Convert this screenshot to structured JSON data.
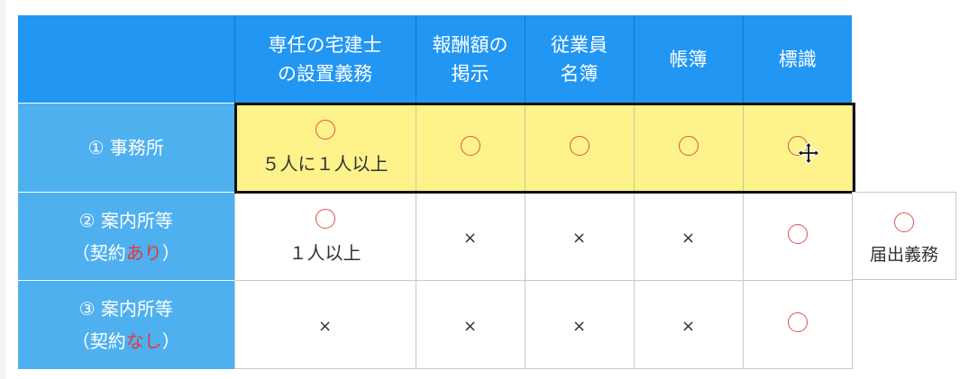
{
  "table": {
    "headers": [
      "",
      "専任の宅建士\nの設置義務",
      "報酬額の\n掲示",
      "従業員\n名簿",
      "帳簿",
      "標識"
    ],
    "rows": [
      {
        "label": "① 事務所",
        "cells": [
          {
            "mark": "circle",
            "note": "５人に１人以上"
          },
          {
            "mark": "circle"
          },
          {
            "mark": "circle"
          },
          {
            "mark": "circle"
          },
          {
            "mark": "circle"
          }
        ]
      },
      {
        "label_line1": "② 案内所等",
        "label_pre": "（契約",
        "label_red": "あり",
        "label_post": "）",
        "cells": [
          {
            "mark": "circle",
            "note": "１人以上"
          },
          {
            "mark": "cross",
            "text": "×"
          },
          {
            "mark": "cross",
            "text": "×"
          },
          {
            "mark": "cross",
            "text": "×"
          },
          {
            "mark": "circle"
          }
        ]
      },
      {
        "label_line1": "③ 案内所等",
        "label_pre": "（契約",
        "label_red": "なし",
        "label_post": "）",
        "cells": [
          {
            "mark": "cross",
            "text": "×"
          },
          {
            "mark": "cross",
            "text": "×"
          },
          {
            "mark": "cross",
            "text": "×"
          },
          {
            "mark": "cross",
            "text": "×"
          },
          {
            "mark": "circle"
          }
        ]
      }
    ],
    "extra_cell": {
      "mark": "circle",
      "note": "届出義務"
    }
  },
  "colors": {
    "header_bg": "#2196f3",
    "rowhead_bg": "#4fb0ef",
    "highlight_bg": "#fdf38a",
    "circle": "#d9534f",
    "red_text": "#e53935"
  },
  "icons": {
    "cursor": "move-cursor-icon"
  }
}
